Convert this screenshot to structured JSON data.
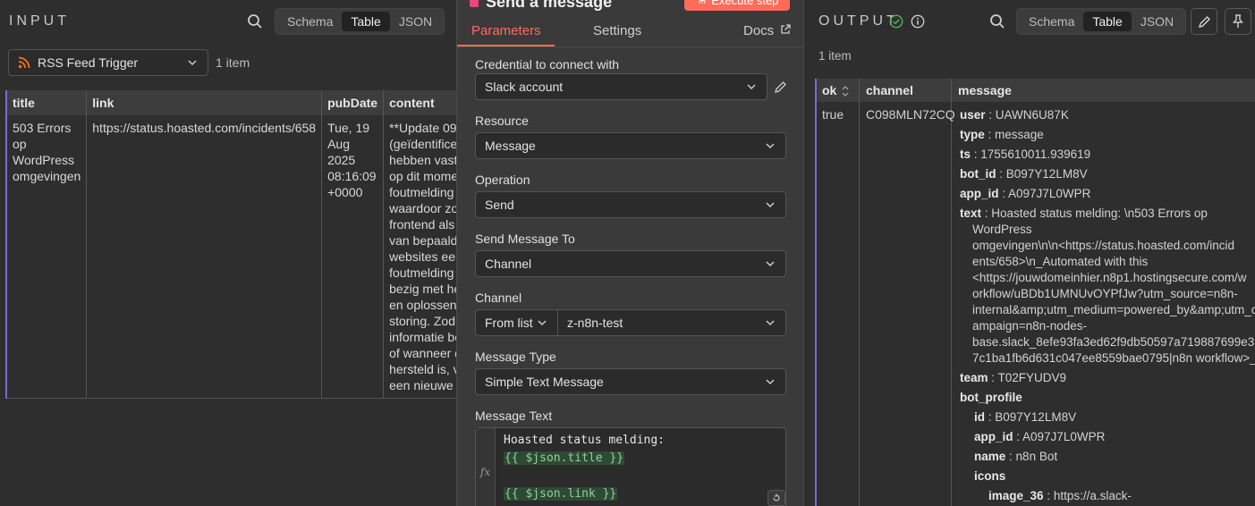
{
  "input": {
    "title": "INPUT",
    "view_tabs": [
      "Schema",
      "Table",
      "JSON"
    ],
    "active_tab": "Table",
    "node_select": "RSS Feed Trigger",
    "item_count": "1 item",
    "columns": [
      "title",
      "link",
      "pubDate",
      "content"
    ],
    "row": {
      "title": "503 Errors op WordPress omgevingen",
      "link": "https://status.hoasted.com/incidents/658",
      "pubDate": "Tue, 19 Aug 2025 08:16:09 +0000",
      "content_lines": [
        "**Update 09",
        "(geïdentifice",
        "hebben vast",
        "op dit mome",
        "foutmelding",
        "waardoor zo",
        "frontend als",
        "van bepaald",
        "websites een",
        "foutmelding",
        "bezig met he",
        "en oplossen",
        "storing. Zodr",
        "informatie be",
        "of wanneer d",
        "hersteld is, v",
        "een nieuwe u"
      ]
    }
  },
  "node": {
    "title": "Send a message",
    "execute_label": "Execute step",
    "tabs": [
      "Parameters",
      "Settings"
    ],
    "active_tab": "Parameters",
    "docs_label": "Docs",
    "fields": {
      "credential_label": "Credential to connect with",
      "credential_value": "Slack account",
      "resource_label": "Resource",
      "resource_value": "Message",
      "operation_label": "Operation",
      "operation_value": "Send",
      "send_to_label": "Send Message To",
      "send_to_value": "Channel",
      "channel_label": "Channel",
      "channel_mode": "From list",
      "channel_value": "z-n8n-test",
      "message_type_label": "Message Type",
      "message_type_value": "Simple Text Message",
      "message_text_label": "Message Text",
      "message_text_line1": "Hoasted status melding:",
      "message_text_line2": "{{ $json.title }}",
      "message_text_line3": "{{ $json.link }}",
      "fx": "fx"
    }
  },
  "output": {
    "title": "OUTPUT",
    "view_tabs": [
      "Schema",
      "Table",
      "JSON"
    ],
    "active_tab": "Table",
    "item_count": "1 item",
    "columns": [
      "ok",
      "channel",
      "message"
    ],
    "row": {
      "ok": "true",
      "channel": "C098MLN72CQ",
      "message": {
        "user": "UAWN6U87K",
        "type": "message",
        "ts": "1755610011.939619",
        "bot_id": "B097Y12LM8V",
        "app_id": "A097J7L0WPR",
        "text_lines": [
          "Hoasted status melding: \\n503 Errors op",
          "WordPress",
          "omgevingen\\n\\n<https://status.hoasted.com/incid",
          "ents/658>\\n_Automated with this",
          "<https://jouwdomeinhier.n8p1.hostingsecure.com/w",
          "orkflow/uBDb1UMNUvOYPfJw?utm_source=n8n-",
          "internal&amp;utm_medium=powered_by&amp;utm_c",
          "ampaign=n8n-nodes-",
          "base.slack_8efe93fa3ed62f9db50597a719887699e3",
          "7c1ba1fb6d631c047ee8559bae0795|n8n workflow>_"
        ],
        "team": "T02FYUDV9",
        "bot_profile_label": "bot_profile",
        "bot_profile": {
          "id": "B097Y12LM8V",
          "app_id": "A097J7L0WPR",
          "name": "n8n Bot",
          "icons_label": "icons",
          "image_36": "https://a.slack-"
        }
      }
    }
  },
  "colors": {
    "accent": "#ff6d5a",
    "success": "#4cae4f",
    "bg": "#2e2e2e",
    "panel": "#3a3a3a"
  }
}
